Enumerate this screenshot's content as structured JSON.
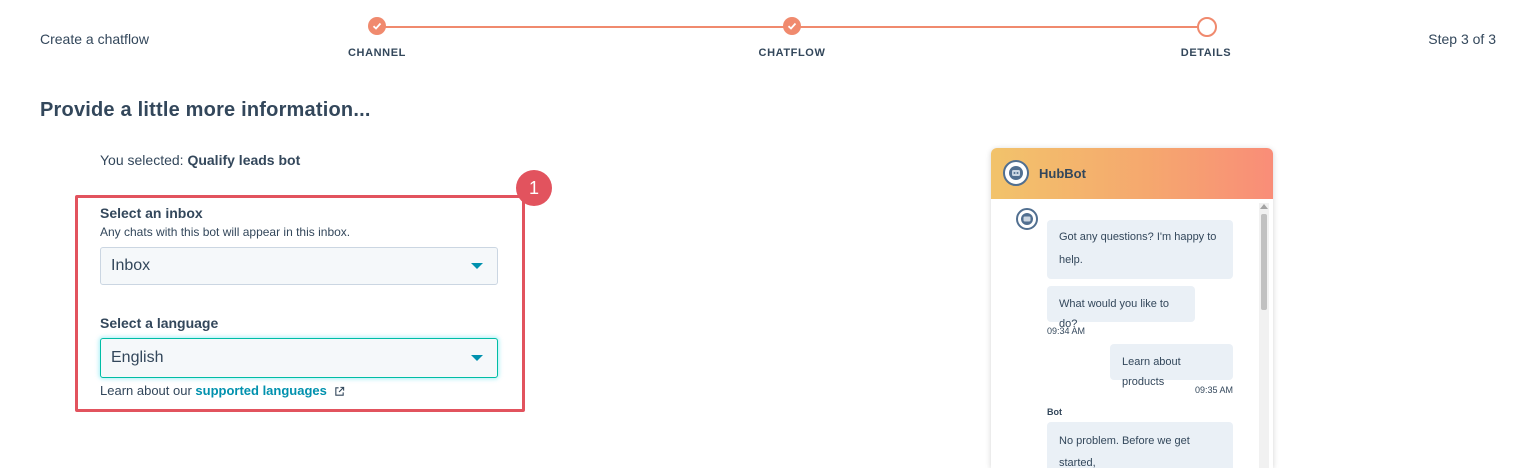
{
  "header": {
    "create_label": "Create a chatflow",
    "step_count": "Step 3 of 3",
    "steps": [
      {
        "label": "CHANNEL",
        "state": "done"
      },
      {
        "label": "CHATFLOW",
        "state": "done"
      },
      {
        "label": "DETAILS",
        "state": "current"
      }
    ]
  },
  "main": {
    "title": "Provide a little more information...",
    "selected_prefix": "You selected: ",
    "selected_value": "Qualify leads bot",
    "callout_number": "1",
    "inbox": {
      "label": "Select an inbox",
      "help": "Any chats with this bot will appear in this inbox.",
      "value": "Inbox"
    },
    "language": {
      "label": "Select a language",
      "value": "English"
    },
    "learn_prefix": "Learn about our ",
    "learn_link": "supported languages"
  },
  "preview": {
    "bot_name": "HubBot",
    "messages": [
      {
        "from": "bot",
        "text": "Got any questions? I'm happy to help."
      },
      {
        "from": "bot",
        "text": "What would you like to do?"
      },
      {
        "from": "time",
        "text": "09:34 AM"
      },
      {
        "from": "user",
        "text": "Learn about products"
      },
      {
        "from": "time",
        "text": "09:35 AM"
      },
      {
        "from": "label",
        "text": "Bot"
      },
      {
        "from": "bot",
        "text": "No problem. Before we get started,"
      }
    ]
  },
  "colors": {
    "accent": "#f08a6e",
    "callout": "#e2535e",
    "link": "#0091ae",
    "text": "#33475b",
    "focus": "#00bda5"
  }
}
